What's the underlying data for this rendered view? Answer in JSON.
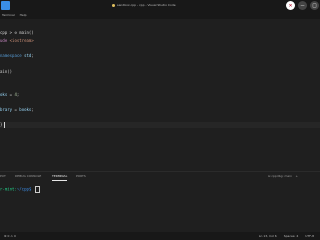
{
  "window": {
    "title": "sandbox.cpp - cpp - Visual Studio Code",
    "buttons": [
      "✕",
      "–",
      "□"
    ]
  },
  "menubar": [
    "Terminal",
    "Help"
  ],
  "code_lines": [
    {
      "tokens": [
        {
          "text": "cpp > ",
          "cls": "txt"
        },
        {
          "text": "⊘ main()",
          "cls": "txt"
        }
      ]
    },
    {
      "tokens": [
        {
          "text": "ude ",
          "cls": "inc"
        },
        {
          "text": "<iostream>",
          "cls": "str"
        }
      ]
    },
    {
      "tokens": []
    },
    {
      "tokens": [
        {
          "text": "namespace ",
          "cls": "kw"
        },
        {
          "text": "std",
          "cls": "id"
        },
        {
          "text": ";",
          "cls": "txt"
        }
      ]
    },
    {
      "tokens": []
    },
    {
      "tokens": [
        {
          "text": "ain()",
          "cls": "txt"
        }
      ]
    },
    {
      "tokens": []
    },
    {
      "tokens": []
    },
    {
      "tokens": [
        {
          "text": "oks",
          "cls": "id"
        },
        {
          "text": " = ",
          "cls": "txt"
        },
        {
          "text": "4",
          "cls": "num"
        },
        {
          "text": ";",
          "cls": "txt"
        }
      ]
    },
    {
      "tokens": []
    },
    {
      "tokens": [
        {
          "text": "brary",
          "cls": "id"
        },
        {
          "text": " = ",
          "cls": "txt"
        },
        {
          "text": "books",
          "cls": "id"
        },
        {
          "text": ";",
          "cls": "txt"
        }
      ]
    },
    {
      "tokens": []
    },
    {
      "tokens": [
        {
          "text": "}",
          "cls": "txt"
        }
      ]
    }
  ],
  "panel": {
    "tabs": [
      "PUT",
      "DEBUG CONSOLE",
      "TERMINAL",
      "PORTS"
    ],
    "active_tab": "TERMINAL",
    "shell": "⊡ cppdbg: main",
    "plus": "+"
  },
  "terminal": {
    "prompt": "r-mint:",
    "path": "~/cpp$",
    "input": ""
  },
  "statusbar": {
    "left": "⊗ 0 ⚠ 0",
    "right": [
      "Ln 13, Col 6",
      "Spaces: 4",
      "UTF-8"
    ]
  },
  "colors": {
    "background": "#1f1f1f",
    "titlebar": "#181818",
    "terminal_prompt": "#23d18b",
    "terminal_path": "#3b8eea"
  }
}
